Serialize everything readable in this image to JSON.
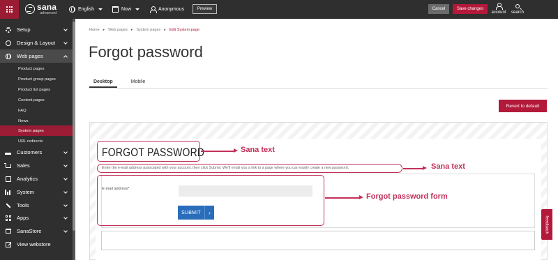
{
  "topbar": {
    "brand_name": "sana",
    "brand_sub": "advanced",
    "language": "English",
    "date": "Now",
    "user": "Anonymous",
    "preview_label": "Preview",
    "cancel_label": "Cancel",
    "save_label": "Save changes",
    "account_label": "account",
    "search_label": "search"
  },
  "sidebar": {
    "items": [
      {
        "label": "Setup",
        "icon": "gear-icon"
      },
      {
        "label": "Design & Layout",
        "icon": "palette-icon"
      },
      {
        "label": "Web pages",
        "icon": "globe-icon"
      },
      {
        "label": "Customers",
        "icon": "people-icon"
      },
      {
        "label": "Sales",
        "icon": "cart-icon"
      },
      {
        "label": "Analytics",
        "icon": "chart-icon"
      },
      {
        "label": "System",
        "icon": "system-icon"
      },
      {
        "label": "Tools",
        "icon": "wrench-icon"
      },
      {
        "label": "Apps",
        "icon": "apps-icon"
      },
      {
        "label": "SanaStore",
        "icon": "store-icon"
      },
      {
        "label": "View webstore",
        "icon": "external-link-icon"
      }
    ],
    "subitems": [
      "Product pages",
      "Product group pages",
      "Product list pages",
      "Content pages",
      "FAQ",
      "News",
      "System pages",
      "URL redirects"
    ]
  },
  "breadcrumb": [
    "Home",
    "Web pages",
    "System pages",
    "Edit System page"
  ],
  "page_title": "Forgot password",
  "tabs": [
    "Desktop",
    "Mobile"
  ],
  "revert_label": "Revert to default",
  "preview": {
    "heading": "FORGOT PASSWORD",
    "instructions": "Enter the e-mail address associated with your account, then click Submit. We'll email you a link to a page where you can easily create a new password.",
    "email_label": "E-mail address*",
    "email_value": "",
    "submit_label": "SUBMIT"
  },
  "annotations": [
    "Sana text",
    "Sana text",
    "Forgot password form"
  ],
  "feedback_label": "feedback",
  "colors": {
    "accent": "#b3193a",
    "sidebar_bg": "#2f2f2f",
    "annotation": "#c2305a",
    "submit": "#2a6ebb"
  }
}
